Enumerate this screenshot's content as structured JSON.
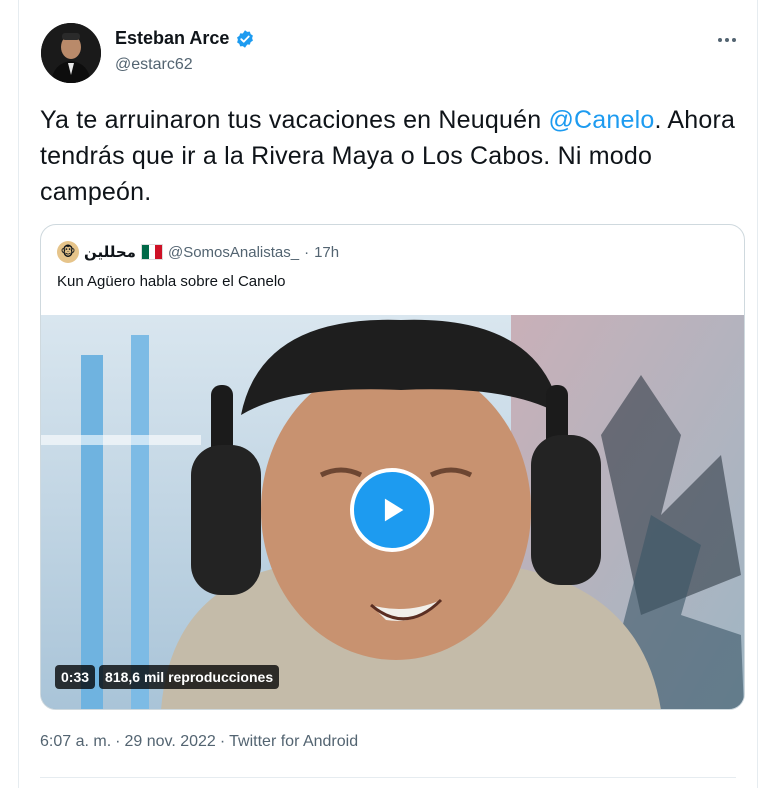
{
  "author": {
    "name": "Esteban Arce",
    "handle": "@estarc62",
    "verified_icon": "verified-badge-icon",
    "accent": "#1d9bf0"
  },
  "tweet": {
    "text_before": "Ya te arruinaron tus vacaciones en Neuquén ",
    "mention": "@Canelo",
    "text_after": ". Ahora tendrás que ir a la Rivera Maya o Los Cabos. Ni modo campeón."
  },
  "quote": {
    "name": "محللين",
    "handle": "@SomosAnalistas_",
    "separator": "·",
    "time": "17h",
    "text": "Kun Agüero habla sobre el Canelo",
    "video": {
      "duration": "0:33",
      "views": "818,6 mil reproducciones",
      "play_icon": "play-icon"
    }
  },
  "meta": {
    "time": "6:07 a. m.",
    "sep1": "·",
    "date": "29 nov. 2022",
    "sep2": "·",
    "client": "Twitter for Android"
  }
}
